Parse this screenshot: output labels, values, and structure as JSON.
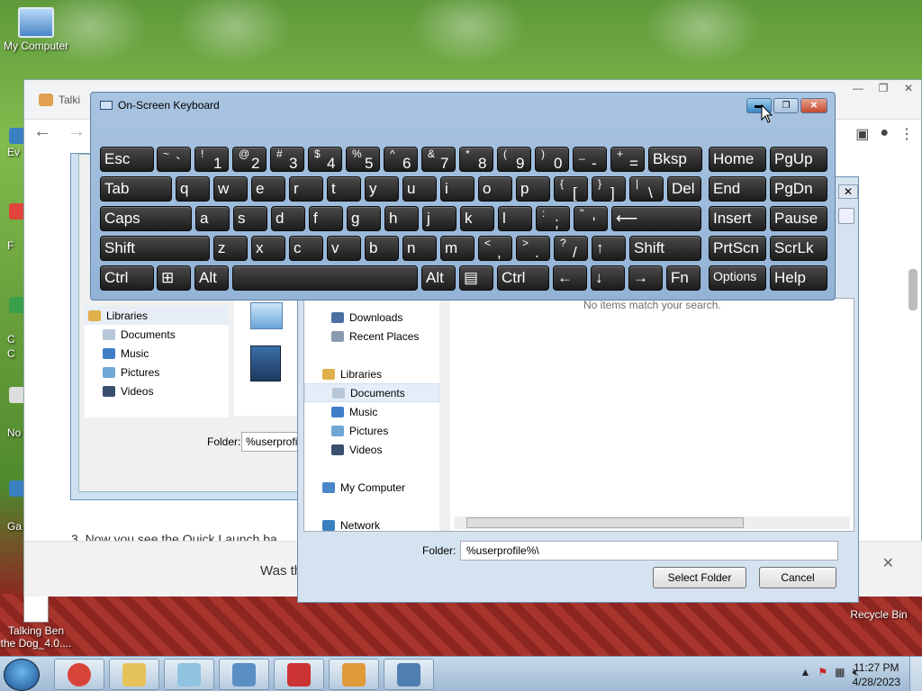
{
  "desktop": {
    "icons": [
      {
        "label": "My Computer"
      },
      {
        "label": "Talking Ben the Dog_4.0...."
      },
      {
        "label": "Recycle Bin"
      }
    ],
    "side_labels": [
      "Ev",
      "F",
      "C",
      "C",
      "No",
      "Ga"
    ]
  },
  "browser": {
    "tab_title": "Talki",
    "page_text": "3. Now you see the Quick Launch ba",
    "feedback_text": "Was th",
    "close_glyph": "✕"
  },
  "dialog_left": {
    "tree": [
      {
        "label": "Libraries",
        "color": "#e0b04a"
      },
      {
        "label": "Documents",
        "color": "#b7c7d8"
      },
      {
        "label": "Music",
        "color": "#3f7fc8"
      },
      {
        "label": "Pictures",
        "color": "#6fa7d6"
      },
      {
        "label": "Videos",
        "color": "#3a4f6e"
      }
    ],
    "folder_label": "Folder:",
    "folder_value": "%userprofile"
  },
  "dialog_right": {
    "tree": [
      {
        "label": "Downloads",
        "color": "#4a6fa0",
        "level": 1,
        "selected": false
      },
      {
        "label": "Recent Places",
        "color": "#8a9ab0",
        "level": 1,
        "selected": false
      },
      {
        "label": "",
        "color": "",
        "level": 1,
        "selected": false
      },
      {
        "label": "Libraries",
        "color": "#e0b04a",
        "level": 0,
        "selected": false
      },
      {
        "label": "Documents",
        "color": "#b7c7d8",
        "level": 1,
        "selected": true
      },
      {
        "label": "Music",
        "color": "#3f7fc8",
        "level": 1,
        "selected": false
      },
      {
        "label": "Pictures",
        "color": "#6fa7d6",
        "level": 1,
        "selected": false
      },
      {
        "label": "Videos",
        "color": "#3a4f6e",
        "level": 1,
        "selected": false
      },
      {
        "label": "",
        "color": "",
        "level": 1,
        "selected": false
      },
      {
        "label": "My Computer",
        "color": "#4a86c8",
        "level": 0,
        "selected": false
      },
      {
        "label": "",
        "color": "",
        "level": 1,
        "selected": false
      },
      {
        "label": "Network",
        "color": "#3a7fc0",
        "level": 0,
        "selected": false
      }
    ],
    "empty_message": "No items match your search.",
    "folder_label": "Folder:",
    "folder_value": "%userprofile%\\",
    "select_button": "Select Folder",
    "cancel_button": "Cancel",
    "close_glyph": "✕"
  },
  "osk": {
    "title": "On-Screen Keyboard",
    "rows": [
      [
        {
          "main": "Esc"
        },
        {
          "up": "~",
          "down": "`"
        },
        {
          "up": "!",
          "down": "1"
        },
        {
          "up": "@",
          "down": "2"
        },
        {
          "up": "#",
          "down": "3"
        },
        {
          "up": "$",
          "down": "4"
        },
        {
          "up": "%",
          "down": "5"
        },
        {
          "up": "^",
          "down": "6"
        },
        {
          "up": "&",
          "down": "7"
        },
        {
          "up": "*",
          "down": "8"
        },
        {
          "up": "(",
          "down": "9"
        },
        {
          "up": ")",
          "down": "0"
        },
        {
          "up": "_",
          "down": "-"
        },
        {
          "up": "+",
          "down": "="
        },
        {
          "main": "Bksp"
        },
        {
          "main": "Home"
        },
        {
          "main": "PgUp"
        }
      ],
      [
        {
          "main": "Tab"
        },
        {
          "main": "q"
        },
        {
          "main": "w"
        },
        {
          "main": "e"
        },
        {
          "main": "r"
        },
        {
          "main": "t"
        },
        {
          "main": "y"
        },
        {
          "main": "u"
        },
        {
          "main": "i"
        },
        {
          "main": "o"
        },
        {
          "main": "p"
        },
        {
          "up": "{",
          "down": "["
        },
        {
          "up": "}",
          "down": "]"
        },
        {
          "up": "|",
          "down": "\\"
        },
        {
          "main": "Del"
        },
        {
          "main": "End"
        },
        {
          "main": "PgDn"
        }
      ],
      [
        {
          "main": "Caps"
        },
        {
          "main": "a"
        },
        {
          "main": "s"
        },
        {
          "main": "d"
        },
        {
          "main": "f"
        },
        {
          "main": "g"
        },
        {
          "main": "h"
        },
        {
          "main": "j"
        },
        {
          "main": "k"
        },
        {
          "main": "l"
        },
        {
          "up": ":",
          "down": ";"
        },
        {
          "up": "\"",
          "down": "'"
        },
        {
          "main": "⟵"
        },
        {
          "main": "Insert"
        },
        {
          "main": "Pause"
        }
      ],
      [
        {
          "main": "Shift"
        },
        {
          "main": "z"
        },
        {
          "main": "x"
        },
        {
          "main": "c"
        },
        {
          "main": "v"
        },
        {
          "main": "b"
        },
        {
          "main": "n"
        },
        {
          "main": "m"
        },
        {
          "up": "<",
          "down": ","
        },
        {
          "up": ">",
          "down": "."
        },
        {
          "up": "?",
          "down": "/"
        },
        {
          "main": "↑"
        },
        {
          "main": "Shift"
        },
        {
          "main": "PrtScn"
        },
        {
          "main": "ScrLk"
        }
      ],
      [
        {
          "main": "Ctrl"
        },
        {
          "main": "⊞"
        },
        {
          "main": "Alt"
        },
        {
          "main": ""
        },
        {
          "main": "Alt"
        },
        {
          "main": "▤"
        },
        {
          "main": "Ctrl"
        },
        {
          "main": "←"
        },
        {
          "main": "↓"
        },
        {
          "main": "→"
        },
        {
          "main": "Fn"
        },
        {
          "main": "Options"
        },
        {
          "main": "Help"
        }
      ]
    ]
  },
  "taskbar": {
    "time": "11:27 PM",
    "date": "4/28/2023",
    "apps": [
      {
        "name": "chrome",
        "color": "#d9443a"
      },
      {
        "name": "explorer",
        "color": "#e6c25a"
      },
      {
        "name": "notepad",
        "color": "#8fc3e0"
      },
      {
        "name": "control-panel",
        "color": "#5a8fc4"
      },
      {
        "name": "snipping",
        "color": "#cc3333"
      },
      {
        "name": "paint",
        "color": "#e09a3a"
      },
      {
        "name": "osk",
        "color": "#4f7fb0"
      }
    ]
  }
}
